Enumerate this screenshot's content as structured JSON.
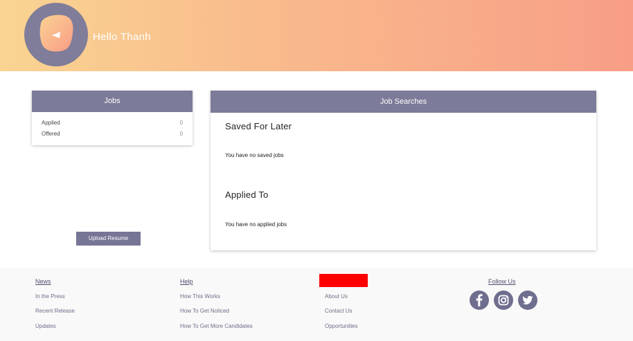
{
  "header": {
    "greeting": "Hello Thanh",
    "avatar_icon": "avatar-blob-icon"
  },
  "jobs": {
    "title": "Jobs",
    "rows": [
      {
        "label": "Applied",
        "count": "0"
      },
      {
        "label": "Offered",
        "count": "0"
      }
    ],
    "upload_label": "Upload Resume"
  },
  "searches": {
    "title": "Job Searches",
    "saved_title": "Saved For Later",
    "saved_empty": "You have no saved jobs",
    "applied_title": "Applied To",
    "applied_empty": "You have no applied jobs"
  },
  "footer": {
    "news": {
      "title": "News",
      "links": [
        "In the Press",
        "Recent Release",
        "Updates"
      ]
    },
    "help": {
      "title": "Help",
      "links": [
        "How This Works",
        "How To Get Noticed",
        "How To Get More Candidates"
      ]
    },
    "company": {
      "links": [
        "About Us",
        "Contact Us",
        "Opportunities"
      ]
    },
    "follow": {
      "title": "Follow Us",
      "icons": [
        "facebook-icon",
        "instagram-icon",
        "twitter-icon"
      ]
    }
  },
  "colors": {
    "accent": "#7c7b99",
    "header_start": "#f9d492",
    "header_end": "#f89e86",
    "red_block": "#ff0000"
  }
}
